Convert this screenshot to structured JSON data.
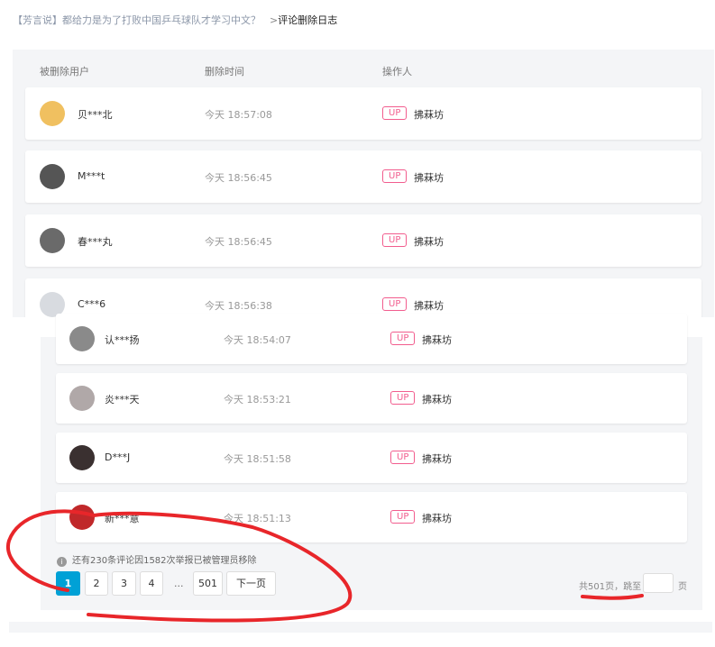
{
  "breadcrumb": {
    "title": "【芳言说】都给力是为了打败中国乒乓球队才学习中文？",
    "separator": ">",
    "current": "评论删除日志"
  },
  "table": {
    "headers": {
      "user": "被删除用户",
      "time": "删除时间",
      "operator": "操作人"
    }
  },
  "rows": [
    {
      "user": "贝***北",
      "time": "今天 18:57:08",
      "badge": "UP",
      "operator": "拂菻坊",
      "avatar_color": "#f0c060"
    },
    {
      "user": "M***t",
      "time": "今天 18:56:45",
      "badge": "UP",
      "operator": "拂菻坊",
      "avatar_color": "#555555"
    },
    {
      "user": "春***丸",
      "time": "今天 18:56:45",
      "badge": "UP",
      "operator": "拂菻坊",
      "avatar_color": "#6a6a6a"
    },
    {
      "user": "C***6",
      "time": "今天 18:56:38",
      "badge": "UP",
      "operator": "拂菻坊",
      "avatar_color": "#d8dbe0"
    }
  ],
  "rows2": [
    {
      "user": "认***扬",
      "time": "今天 18:54:07",
      "badge": "UP",
      "operator": "拂菻坊",
      "avatar_color": "#8a8a8a"
    },
    {
      "user": "炎***天",
      "time": "今天 18:53:21",
      "badge": "UP",
      "operator": "拂菻坊",
      "avatar_color": "#b0a8a8"
    },
    {
      "user": "D***J",
      "time": "今天 18:51:58",
      "badge": "UP",
      "operator": "拂菻坊",
      "avatar_color": "#3a3030"
    },
    {
      "user": "新***意",
      "time": "今天 18:51:13",
      "badge": "UP",
      "operator": "拂菻坊",
      "avatar_color": "#c0282a"
    }
  ],
  "info_text": "还有230条评论因1582次举报已被管理员移除",
  "info_icon": "info-circle-icon",
  "pagination": {
    "pages": [
      "1",
      "2",
      "3",
      "4"
    ],
    "ellipsis": "...",
    "last": "501",
    "next": "下一页",
    "total": "共501页，跳至",
    "suffix": "页",
    "active": "1"
  },
  "colors": {
    "accent": "#00a1d6",
    "badge": "#f25d8e",
    "annotation": "#e8262a"
  }
}
